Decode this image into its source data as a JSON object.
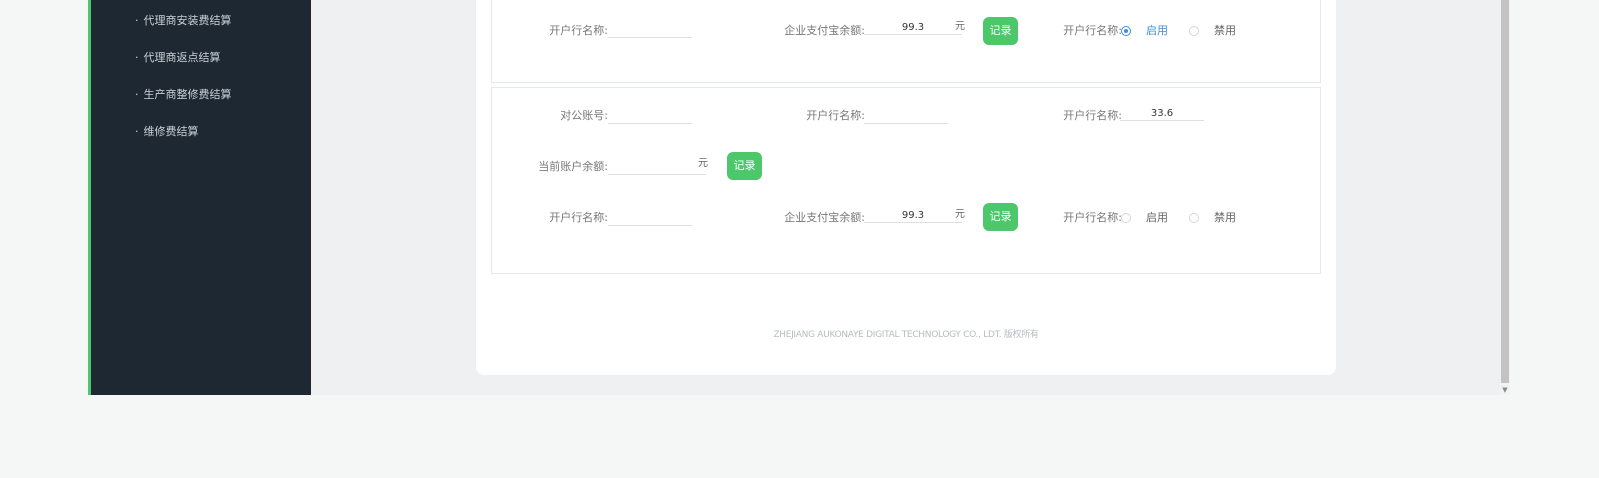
{
  "sidebar": {
    "items": [
      {
        "label": "代理商安装费结算"
      },
      {
        "label": "代理商返点结算"
      },
      {
        "label": "生产商整修费结算"
      },
      {
        "label": "维修费结算"
      }
    ],
    "bullet": "·"
  },
  "panel1": {
    "row3": {
      "bank_name_label": "开户行名称:",
      "bank_name_value": "",
      "alipay_balance_label": "企业支付宝余额:",
      "alipay_balance_value": "99.3",
      "unit": "元",
      "record_label": "记录",
      "status_label": "开户行名称:",
      "enable_label": "启用",
      "disable_label": "禁用",
      "selected": "enable"
    }
  },
  "panel2": {
    "row1": {
      "account_label": "对公账号:",
      "account_value": "",
      "bank_name_label": "开户行名称:",
      "bank_name_value": "",
      "bank_name2_label": "开户行名称:",
      "bank_name2_value": "33.6"
    },
    "row2": {
      "balance_label": "当前账户余额:",
      "balance_value": "",
      "unit": "元",
      "record_label": "记录"
    },
    "row3": {
      "bank_name_label": "开户行名称:",
      "bank_name_value": "",
      "alipay_balance_label": "企业支付宝余额:",
      "alipay_balance_value": "99.3",
      "unit": "元",
      "record_label": "记录",
      "status_label": "开户行名称:",
      "enable_label": "启用",
      "disable_label": "禁用",
      "selected": "none"
    }
  },
  "footer": {
    "copyright": "ZHEJIANG AUKONAYE DIGITAL TECHNOLOGY CO., LDT. 版权所有"
  },
  "colors": {
    "sidebar_bg": "#1d2833",
    "accent_green": "#4cc86b",
    "radio_blue": "#3b8fe0"
  }
}
